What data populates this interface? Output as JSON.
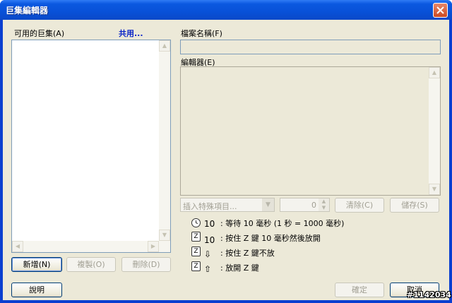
{
  "window": {
    "title": "巨集編輯器"
  },
  "left": {
    "macros_label": "可用的巨集(A)",
    "share_link": "共用...",
    "buttons": {
      "new": "新增(N)",
      "copy": "複製(O)",
      "delete": "刪除(D)"
    }
  },
  "right": {
    "filename_label": "檔案名稱(F)",
    "filename_value": "",
    "editor_label": "編輯器(E)",
    "insert_select": "插入特殊項目...",
    "spinner_value": "0",
    "clear_button": "清除(C)",
    "save_button": "儲存(S)"
  },
  "legend": [
    {
      "icon": "clock-icon",
      "value": "10",
      "text": ": 等待 10 毫秒 (1 秒 = 1000 毫秒)"
    },
    {
      "icon": "z-key-icon",
      "key": "Z",
      "value": "10",
      "text": ": 按住 Z 鍵 10 毫秒然後放開"
    },
    {
      "icon": "z-key-down-icon",
      "key": "Z",
      "arrow": "⇩",
      "text": ": 按住 Z 鍵不放"
    },
    {
      "icon": "z-key-up-icon",
      "key": "Z",
      "arrow": "⇧",
      "text": ": 放開 Z 鍵"
    }
  ],
  "footer": {
    "help": "說明",
    "ok": "確定",
    "cancel": "取消"
  },
  "watermark": "#1142034"
}
